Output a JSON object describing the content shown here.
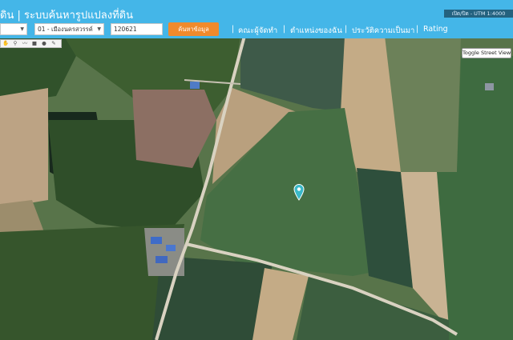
{
  "header": {
    "title": "ดิน | ระบบค้นหารูปแปลงที่ดิน",
    "utm_label": "เปิด/ปิด - UTM 1:4000"
  },
  "search": {
    "province_value": "",
    "amphoe_value": "01 - เมืองนครสวรรค์",
    "parcel_value": "120621",
    "search_button_label": "ค้นหาข้อมูล"
  },
  "nav": {
    "items": [
      {
        "label": "คณะผู้จัดทำ"
      },
      {
        "label": "ตำแหน่งของฉัน"
      },
      {
        "label": "ประวัติความเป็นมา"
      },
      {
        "label": "Rating"
      }
    ]
  },
  "map": {
    "street_view_label": "Toggle Street View",
    "marker_color": "#3ab8c8",
    "tools": [
      "pan-icon",
      "marker-icon",
      "polyline-icon",
      "rectangle-icon",
      "circle-icon",
      "edit-icon"
    ]
  },
  "colors": {
    "header": "#44b6e8",
    "search_button": "#f08a2c"
  }
}
